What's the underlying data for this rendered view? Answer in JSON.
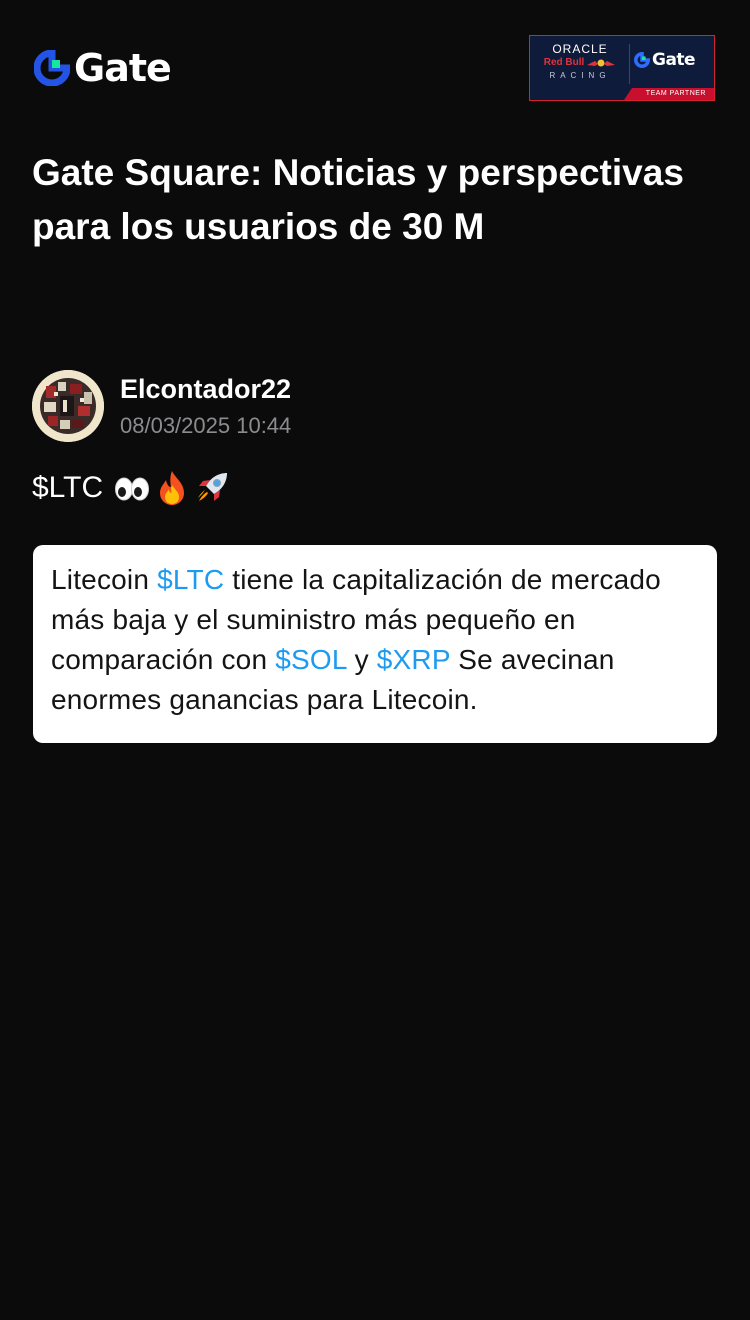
{
  "header": {
    "brand_name": "Gate",
    "brand_icon": "gate-logo-icon",
    "brand_color": "#2354e6",
    "brand_accent": "#17e6a1",
    "partner_badge": {
      "line1": "ORACLE",
      "line2": "Red Bull",
      "line3": "RACING",
      "gate_text": "Gate",
      "strip_text": "TEAM PARTNER",
      "accent_color": "#c8102e",
      "background_color": "#0f1b3a"
    }
  },
  "page": {
    "title": "Gate Square: Noticias y perspectivas para los usuarios de 30 M"
  },
  "post": {
    "author_name": "Elcontador22",
    "timestamp": "08/03/2025 10:44",
    "text": "$LTC",
    "emojis": [
      "eyes-emoji",
      "fire-emoji",
      "rocket-emoji"
    ],
    "image_text": {
      "p1": "Litecoin ",
      "tag1": "$LTC",
      "p2": " tiene la capitalización de mercado más baja y el suministro más pequeño en comparación con ",
      "tag2": "$SOL",
      "p3": " y ",
      "tag3": "$XRP",
      "p4": " Se avecinan enormes ganancias para Litecoin.",
      "cashtag_color": "#1d9bf0"
    }
  }
}
